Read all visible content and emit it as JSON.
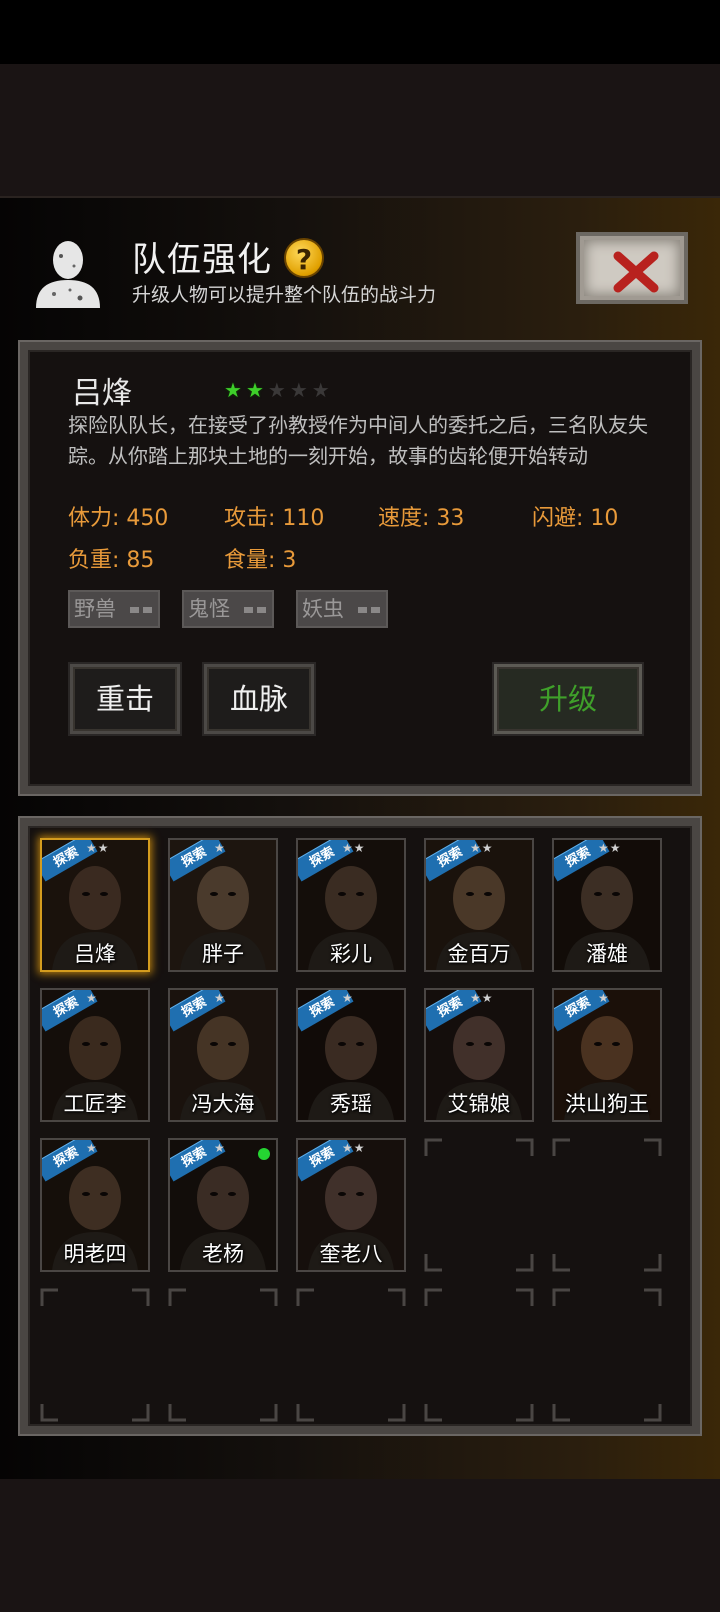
{
  "header": {
    "title": "队伍强化",
    "help_icon": "question-mark",
    "subtitle": "升级人物可以提升整个队伍的战斗力",
    "close_icon": "x-cross"
  },
  "character": {
    "name": "吕烽",
    "stars": 2,
    "max_stars": 5,
    "description": "探险队队长，在接受了孙教授作为中间人的委托之后，三名队友失踪。从你踏上那块土地的一刻开始，故事的齿轮便开始转动",
    "stats": {
      "stamina": "体力: 450",
      "attack": "攻击: 110",
      "speed": "速度: 33",
      "dodge": "闪避: 10",
      "load": "负重: 85",
      "food": "食量: 3"
    },
    "tags": [
      "野兽",
      "鬼怪",
      "妖虫"
    ]
  },
  "actions": {
    "skill1": "重击",
    "skill2": "血脉",
    "upgrade": "升级"
  },
  "colors": {
    "stat_text": "#e89a3a",
    "star_on": "#3ecf2a",
    "upgrade_text": "#3fa02a",
    "selected_border": "#d49c1e",
    "explore_badge": "#1f6fb0"
  },
  "roster": [
    {
      "name": "吕烽",
      "badge": "探索",
      "stars": "★★",
      "selected": true
    },
    {
      "name": "胖子",
      "badge": "探索",
      "stars": "★"
    },
    {
      "name": "彩儿",
      "badge": "探索",
      "stars": "★★"
    },
    {
      "name": "金百万",
      "badge": "探索",
      "stars": "★★"
    },
    {
      "name": "潘雄",
      "badge": "探索",
      "stars": "★★"
    },
    {
      "name": "工匠李",
      "badge": "探索",
      "stars": "★"
    },
    {
      "name": "冯大海",
      "badge": "探索",
      "stars": "★"
    },
    {
      "name": "秀瑶",
      "badge": "探索",
      "stars": "★"
    },
    {
      "name": "艾锦娘",
      "badge": "探索",
      "stars": "★★"
    },
    {
      "name": "洪山狗王",
      "badge": "探索",
      "stars": "★"
    },
    {
      "name": "明老四",
      "badge": "探索",
      "stars": "★"
    },
    {
      "name": "老杨",
      "badge": "探索",
      "stars": "★",
      "online": true
    },
    {
      "name": "奎老八",
      "badge": "探索",
      "stars": "★★"
    }
  ]
}
